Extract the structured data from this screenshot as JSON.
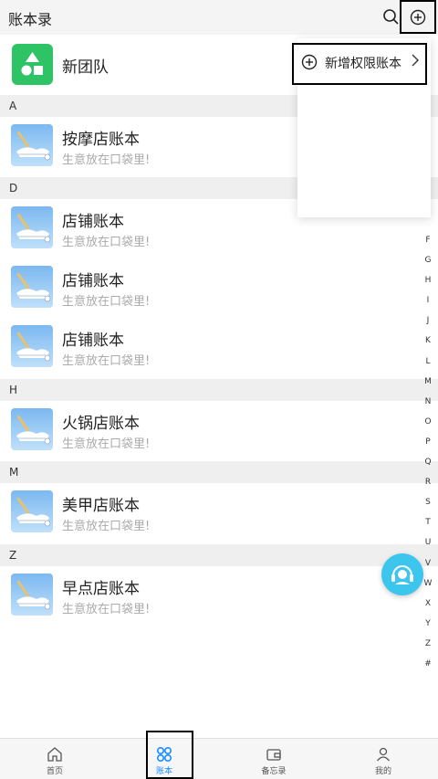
{
  "header": {
    "title": "账本录"
  },
  "team": {
    "name": "新团队"
  },
  "sections": [
    {
      "letter": "A",
      "items": [
        {
          "name": "按摩店账本",
          "desc": "生意放在口袋里!"
        }
      ]
    },
    {
      "letter": "D",
      "items": [
        {
          "name": "店铺账本",
          "desc": "生意放在口袋里!"
        },
        {
          "name": "店铺账本",
          "desc": "生意放在口袋里!"
        },
        {
          "name": "店铺账本",
          "desc": "生意放在口袋里!"
        }
      ]
    },
    {
      "letter": "H",
      "items": [
        {
          "name": "火锅店账本",
          "desc": "生意放在口袋里!"
        }
      ]
    },
    {
      "letter": "M",
      "items": [
        {
          "name": "美甲店账本",
          "desc": "生意放在口袋里!"
        }
      ]
    },
    {
      "letter": "Z",
      "items": [
        {
          "name": "早点店账本",
          "desc": "生意放在口袋里!"
        }
      ]
    }
  ],
  "index_letters": [
    "F",
    "G",
    "H",
    "I",
    "J",
    "K",
    "L",
    "M",
    "N",
    "O",
    "P",
    "Q",
    "R",
    "S",
    "T",
    "U",
    "V",
    "W",
    "X",
    "Y",
    "Z",
    "#"
  ],
  "dropdown": {
    "item_label": "新增权限账本"
  },
  "tabs": [
    {
      "label": "首页",
      "icon": "home-icon"
    },
    {
      "label": "账本",
      "icon": "ledger-icon",
      "active": true
    },
    {
      "label": "备忘录",
      "icon": "wallet-icon"
    },
    {
      "label": "我的",
      "icon": "user-icon"
    }
  ],
  "colors": {
    "accent": "#1a8cff",
    "team_logo": "#2ec466",
    "fab": "#3cc6ee"
  }
}
